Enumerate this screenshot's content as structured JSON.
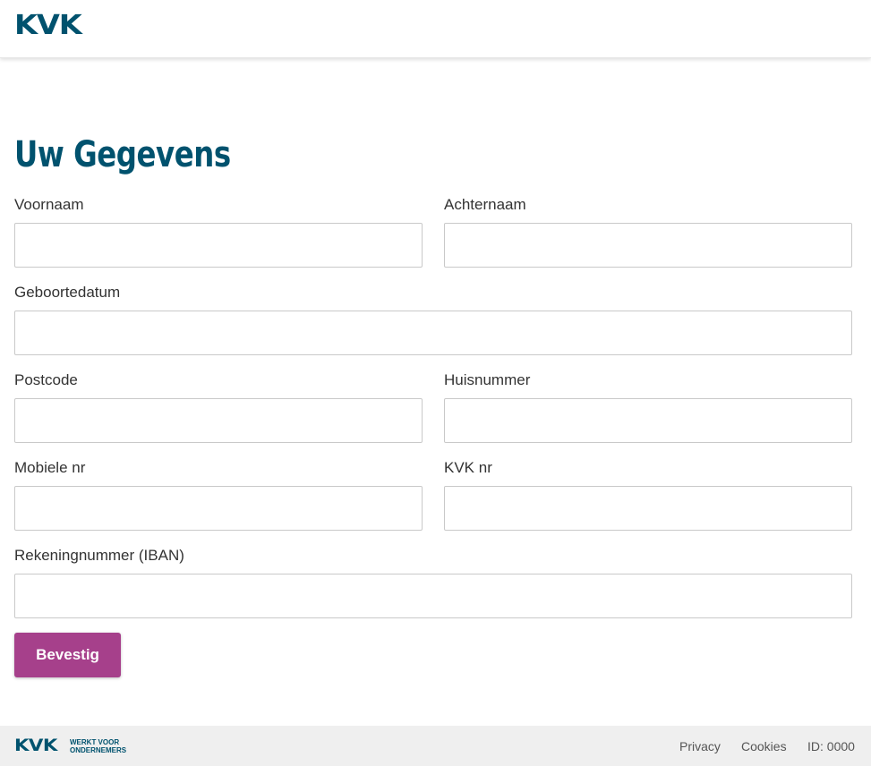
{
  "header": {
    "logo": "KVK"
  },
  "page": {
    "title": "Uw Gegevens"
  },
  "form": {
    "fields": {
      "voornaam": {
        "label": "Voornaam",
        "value": ""
      },
      "achternaam": {
        "label": "Achternaam",
        "value": ""
      },
      "geboortedatum": {
        "label": "Geboortedatum",
        "value": ""
      },
      "postcode": {
        "label": "Postcode",
        "value": ""
      },
      "huisnummer": {
        "label": "Huisnummer",
        "value": ""
      },
      "mobiele_nr": {
        "label": "Mobiele nr",
        "value": ""
      },
      "kvk_nr": {
        "label": "KVK nr",
        "value": ""
      },
      "iban": {
        "label": "Rekeningnummer (IBAN)",
        "value": ""
      }
    },
    "submit_label": "Bevestig"
  },
  "footer": {
    "logo": "KVK",
    "tagline_line1": "WERKT VOOR",
    "tagline_line2": "ONDERNEMERS",
    "links": {
      "privacy": "Privacy",
      "cookies": "Cookies"
    },
    "id_text": "ID: 0000"
  },
  "colors": {
    "brand": "#00526e",
    "button": "#a6408b",
    "footer_bg": "#efefef"
  }
}
